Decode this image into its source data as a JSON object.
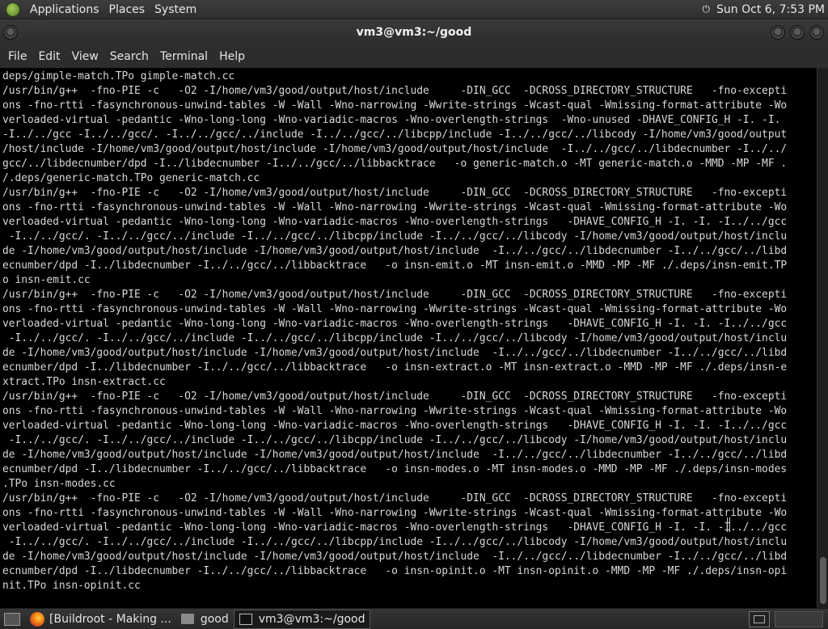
{
  "top_panel": {
    "menus": [
      "Applications",
      "Places",
      "System"
    ],
    "clock": "Sun Oct  6,  7:53 PM"
  },
  "window": {
    "title": "vm3@vm3:~/good"
  },
  "menubar": [
    "File",
    "Edit",
    "View",
    "Search",
    "Terminal",
    "Help"
  ],
  "terminal": {
    "lines": [
      "deps/gimple-match.TPo gimple-match.cc",
      "/usr/bin/g++  -fno-PIE -c   -O2 -I/home/vm3/good/output/host/include     -DIN_GCC  -DCROSS_DIRECTORY_STRUCTURE   -fno-excepti",
      "ons -fno-rtti -fasynchronous-unwind-tables -W -Wall -Wno-narrowing -Wwrite-strings -Wcast-qual -Wmissing-format-attribute -Wo",
      "verloaded-virtual -pedantic -Wno-long-long -Wno-variadic-macros -Wno-overlength-strings  -Wno-unused -DHAVE_CONFIG_H -I. -I.",
      "-I../../gcc -I../../gcc/. -I../../gcc/../include -I../../gcc/../libcpp/include -I../../gcc/../libcody -I/home/vm3/good/output",
      "/host/include -I/home/vm3/good/output/host/include -I/home/vm3/good/output/host/include  -I../../gcc/../libdecnumber -I../../",
      "gcc/../libdecnumber/dpd -I../libdecnumber -I../../gcc/../libbacktrace   -o generic-match.o -MT generic-match.o -MMD -MP -MF .",
      "/.deps/generic-match.TPo generic-match.cc",
      "/usr/bin/g++  -fno-PIE -c   -O2 -I/home/vm3/good/output/host/include     -DIN_GCC  -DCROSS_DIRECTORY_STRUCTURE   -fno-excepti",
      "ons -fno-rtti -fasynchronous-unwind-tables -W -Wall -Wno-narrowing -Wwrite-strings -Wcast-qual -Wmissing-format-attribute -Wo",
      "verloaded-virtual -pedantic -Wno-long-long -Wno-variadic-macros -Wno-overlength-strings   -DHAVE_CONFIG_H -I. -I. -I../../gcc",
      " -I../../gcc/. -I../../gcc/../include -I../../gcc/../libcpp/include -I../../gcc/../libcody -I/home/vm3/good/output/host/inclu",
      "de -I/home/vm3/good/output/host/include -I/home/vm3/good/output/host/include  -I../../gcc/../libdecnumber -I../../gcc/../libd",
      "ecnumber/dpd -I../libdecnumber -I../../gcc/../libbacktrace   -o insn-emit.o -MT insn-emit.o -MMD -MP -MF ./.deps/insn-emit.TP",
      "o insn-emit.cc",
      "/usr/bin/g++  -fno-PIE -c   -O2 -I/home/vm3/good/output/host/include     -DIN_GCC  -DCROSS_DIRECTORY_STRUCTURE   -fno-excepti",
      "ons -fno-rtti -fasynchronous-unwind-tables -W -Wall -Wno-narrowing -Wwrite-strings -Wcast-qual -Wmissing-format-attribute -Wo",
      "verloaded-virtual -pedantic -Wno-long-long -Wno-variadic-macros -Wno-overlength-strings   -DHAVE_CONFIG_H -I. -I. -I../../gcc",
      " -I../../gcc/. -I../../gcc/../include -I../../gcc/../libcpp/include -I../../gcc/../libcody -I/home/vm3/good/output/host/inclu",
      "de -I/home/vm3/good/output/host/include -I/home/vm3/good/output/host/include  -I../../gcc/../libdecnumber -I../../gcc/../libd",
      "ecnumber/dpd -I../libdecnumber -I../../gcc/../libbacktrace   -o insn-extract.o -MT insn-extract.o -MMD -MP -MF ./.deps/insn-e",
      "xtract.TPo insn-extract.cc",
      "/usr/bin/g++  -fno-PIE -c   -O2 -I/home/vm3/good/output/host/include     -DIN_GCC  -DCROSS_DIRECTORY_STRUCTURE   -fno-excepti",
      "ons -fno-rtti -fasynchronous-unwind-tables -W -Wall -Wno-narrowing -Wwrite-strings -Wcast-qual -Wmissing-format-attribute -Wo",
      "verloaded-virtual -pedantic -Wno-long-long -Wno-variadic-macros -Wno-overlength-strings   -DHAVE_CONFIG_H -I. -I. -I../../gcc",
      " -I../../gcc/. -I../../gcc/../include -I../../gcc/../libcpp/include -I../../gcc/../libcody -I/home/vm3/good/output/host/inclu",
      "de -I/home/vm3/good/output/host/include -I/home/vm3/good/output/host/include  -I../../gcc/../libdecnumber -I../../gcc/../libd",
      "ecnumber/dpd -I../libdecnumber -I../../gcc/../libbacktrace   -o insn-modes.o -MT insn-modes.o -MMD -MP -MF ./.deps/insn-modes",
      ".TPo insn-modes.cc",
      "/usr/bin/g++  -fno-PIE -c   -O2 -I/home/vm3/good/output/host/include     -DIN_GCC  -DCROSS_DIRECTORY_STRUCTURE   -fno-excepti",
      "ons -fno-rtti -fasynchronous-unwind-tables -W -Wall -Wno-narrowing -Wwrite-strings -Wcast-qual -Wmissing-format-attribute -Wo",
      "verloaded-virtual -pedantic -Wno-long-long -Wno-variadic-macros -Wno-overlength-strings   -DHAVE_CONFIG_H -I. -I. -I../../gcc",
      " -I../../gcc/. -I../../gcc/../include -I../../gcc/../libcpp/include -I../../gcc/../libcody -I/home/vm3/good/output/host/inclu",
      "de -I/home/vm3/good/output/host/include -I/home/vm3/good/output/host/include  -I../../gcc/../libdecnumber -I../../gcc/../libd",
      "ecnumber/dpd -I../libdecnumber -I../../gcc/../libbacktrace   -o insn-opinit.o -MT insn-opinit.o -MMD -MP -MF ./.deps/insn-opi",
      "nit.TPo insn-opinit.cc"
    ]
  },
  "taskbar": {
    "tasks": [
      {
        "label": "[Buildroot - Making ...",
        "icon": "firefox-icon"
      },
      {
        "label": "good",
        "icon": "folder-icon"
      },
      {
        "label": "vm3@vm3:~/good",
        "icon": "terminal-icon"
      }
    ]
  }
}
